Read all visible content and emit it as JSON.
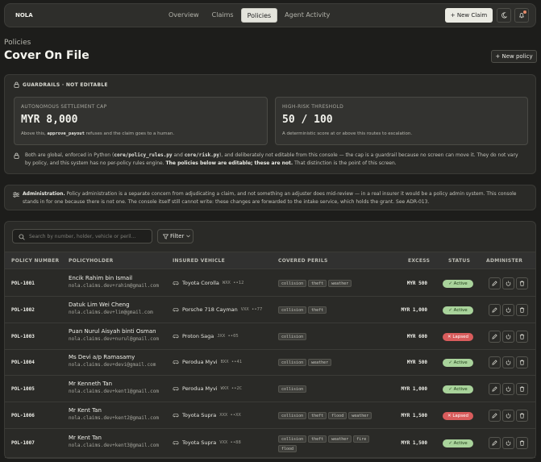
{
  "nav": {
    "brand": "NOLA",
    "tabs": [
      {
        "label": "Overview"
      },
      {
        "label": "Claims"
      },
      {
        "label": "Policies",
        "active": true
      },
      {
        "label": "Agent Activity"
      }
    ],
    "new_claim": "+  New Claim",
    "theme_icon": "moon-icon",
    "notify_icon": "bell-icon"
  },
  "header": {
    "kicker": "Policies",
    "title": "Cover On File",
    "new_policy": "+  New policy"
  },
  "guardrails": {
    "heading": "GUARDRAILS · NOT EDITABLE",
    "cards": [
      {
        "label": "AUTONOMOUS SETTLEMENT CAP",
        "value": "MYR 8,000",
        "note_pre": "Above this, ",
        "note_code": "approve_payout",
        "note_post": " refuses and the claim goes to a human."
      },
      {
        "label": "HIGH-RISK THRESHOLD",
        "value": "50 / 100",
        "note": "A deterministic score at or above this routes to escalation."
      }
    ],
    "body": {
      "p1": "Both are global, enforced in Python (",
      "c1": "core/policy_rules.py",
      "p2": " and ",
      "c2": "core/risk.py",
      "p3": "), and deliberately not editable from this console — the cap is a guardrail because no screen can move it. They do not vary by policy, and this system has no per-policy rules engine. ",
      "bold": "The policies below are editable; these are not.",
      "p4": " That distinction is the point of this screen."
    }
  },
  "admin": {
    "lead": "Administration.",
    "text": " Policy administration is a separate concern from adjudicating a claim, and not something an adjuster does mid-review — in a real insurer it would be a policy admin system. This console stands in for one because there is not one. The console itself still cannot write: these changes are forwarded to the intake service, which holds the grant. See ADR-013."
  },
  "table": {
    "search_placeholder": "Search by number, holder, vehicle or peril…",
    "filter_label": "Filter",
    "columns": [
      "POLICY NUMBER",
      "POLICYHOLDER",
      "INSURED VEHICLE",
      "COVERED PERILS",
      "EXCESS",
      "STATUS",
      "ADMINISTER"
    ],
    "rows": [
      {
        "id": "POL-1001",
        "name": "Encik Rahim bin Ismail",
        "email": "nola.claims.dev+rahim@gmail.com",
        "vehicle": "Toyota Corolla",
        "plate": "WXX ••12",
        "perils": [
          "collision",
          "theft",
          "weather"
        ],
        "excess": "MYR 500",
        "status": "Active"
      },
      {
        "id": "POL-1002",
        "name": "Datuk Lim Wei Cheng",
        "email": "nola.claims.dev+lim@gmail.com",
        "vehicle": "Porsche 718 Cayman",
        "plate": "VXX ••77",
        "perils": [
          "collision",
          "theft"
        ],
        "excess": "MYR 1,000",
        "status": "Active"
      },
      {
        "id": "POL-1003",
        "name": "Puan Nurul Aisyah binti Osman",
        "email": "nola.claims.dev+nurul@gmail.com",
        "vehicle": "Proton Saga",
        "plate": "JXX ••05",
        "perils": [
          "collision"
        ],
        "excess": "MYR 600",
        "status": "Lapsed"
      },
      {
        "id": "POL-1004",
        "name": "Ms Devi a/p Ramasamy",
        "email": "nola.claims.dev+devi@gmail.com",
        "vehicle": "Perodua Myvi",
        "plate": "BXX ••41",
        "perils": [
          "collision",
          "weather"
        ],
        "excess": "MYR 500",
        "status": "Active"
      },
      {
        "id": "POL-1005",
        "name": "Mr Kenneth Tan",
        "email": "nola.claims.dev+kent1@gmail.com",
        "vehicle": "Perodua Myvi",
        "plate": "WXX ••2C",
        "perils": [
          "collision"
        ],
        "excess": "MYR 1,000",
        "status": "Active"
      },
      {
        "id": "POL-1006",
        "name": "Mr Kent Tan",
        "email": "nola.claims.dev+kent2@gmail.com",
        "vehicle": "Toyota Supra",
        "plate": "XXX ••XX",
        "perils": [
          "collision",
          "theft",
          "flood",
          "weather"
        ],
        "excess": "MYR 1,500",
        "status": "Lapsed"
      },
      {
        "id": "POL-1007",
        "name": "Mr Kent Tan",
        "email": "nola.claims.dev+kent3@gmail.com",
        "vehicle": "Toyota Supra",
        "plate": "VXX ••88",
        "perils": [
          "collision",
          "theft",
          "weather",
          "fire",
          "flood"
        ],
        "excess": "MYR 1,500",
        "status": "Active"
      }
    ]
  },
  "colors": {
    "active": "#a9d39b",
    "lapsed": "#d95c5c",
    "surface": "#2a2a27"
  }
}
